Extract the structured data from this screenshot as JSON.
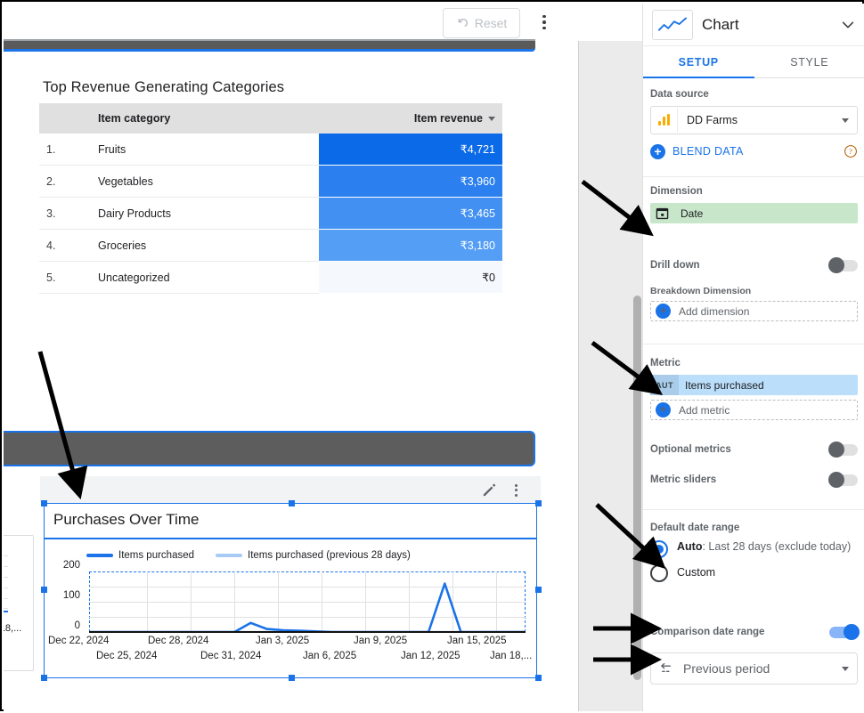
{
  "toolbar": {
    "reset_label": "Reset",
    "undo_icon": "undo-icon",
    "more_icon": "more-vertical-icon"
  },
  "report": {
    "table_widget": {
      "title": "Top Revenue Generating Categories",
      "columns": [
        "",
        "Item category",
        "Item revenue"
      ],
      "sort_column": "Item revenue",
      "rows": [
        {
          "rank": "1.",
          "category": "Fruits",
          "revenue": "₹4,721",
          "bar_color": "#0a6ae8",
          "bar_pct": 100
        },
        {
          "rank": "2.",
          "category": "Vegetables",
          "revenue": "₹3,960",
          "bar_color": "#2b7fef",
          "bar_pct": 84
        },
        {
          "rank": "3.",
          "category": "Dairy Products",
          "revenue": "₹3,465",
          "bar_color": "#4190f2",
          "bar_pct": 73
        },
        {
          "rank": "4.",
          "category": "Groceries",
          "revenue": "₹3,180",
          "bar_color": "#559ef6",
          "bar_pct": 67
        },
        {
          "rank": "5.",
          "category": "Uncategorized",
          "revenue": "₹0",
          "bar_color": "#f5f8fd",
          "bar_pct": 0
        }
      ]
    },
    "chart_widget": {
      "title": "Purchases Over Time",
      "edit_icon": "pencil-icon",
      "more_icon": "more-vertical-icon",
      "selected": true
    }
  },
  "chart_data": {
    "type": "line",
    "title": "Purchases Over Time",
    "xlabel": "",
    "ylabel": "",
    "ylim": [
      0,
      200
    ],
    "yticks": [
      0,
      100,
      200
    ],
    "grid": true,
    "legend_position": "top",
    "xtick_labels_row1": [
      "Dec 22, 2024",
      "Dec 28, 2024",
      "Jan 3, 2025",
      "Jan 9, 2025",
      "Jan 15, 2025"
    ],
    "xtick_labels_row2": [
      "Dec 25, 2024",
      "Dec 31, 2024",
      "Jan 6, 2025",
      "Jan 12, 2025",
      "Jan 18,..."
    ],
    "x": [
      "Dec 22, 2024",
      "Dec 23, 2024",
      "Dec 24, 2024",
      "Dec 25, 2024",
      "Dec 26, 2024",
      "Dec 27, 2024",
      "Dec 28, 2024",
      "Dec 29, 2024",
      "Dec 30, 2024",
      "Dec 31, 2024",
      "Jan 1, 2025",
      "Jan 2, 2025",
      "Jan 3, 2025",
      "Jan 4, 2025",
      "Jan 5, 2025",
      "Jan 6, 2025",
      "Jan 7, 2025",
      "Jan 8, 2025",
      "Jan 9, 2025",
      "Jan 10, 2025",
      "Jan 11, 2025",
      "Jan 12, 2025",
      "Jan 13, 2025",
      "Jan 14, 2025",
      "Jan 15, 2025",
      "Jan 16, 2025",
      "Jan 17, 2025",
      "Jan 18, 2025"
    ],
    "series": [
      {
        "name": "Items purchased",
        "color": "#1a73e8",
        "values": [
          0,
          0,
          0,
          0,
          0,
          0,
          0,
          0,
          0,
          0,
          30,
          10,
          6,
          4,
          2,
          0,
          0,
          0,
          0,
          0,
          0,
          0,
          160,
          0,
          0,
          0,
          0,
          0
        ]
      },
      {
        "name": "Items purchased (previous 28 days)",
        "color": "#a8cbf5",
        "values": [
          0,
          0,
          0,
          0,
          0,
          0,
          0,
          0,
          0,
          0,
          0,
          0,
          0,
          0,
          0,
          0,
          0,
          0,
          0,
          0,
          0,
          0,
          0,
          0,
          0,
          0,
          0,
          0
        ]
      }
    ]
  },
  "panel": {
    "header": {
      "chart_type_icon": "line-chart-icon",
      "title": "Chart",
      "collapse_icon": "chevron-down-icon"
    },
    "tabs": [
      {
        "label": "SETUP",
        "active": true
      },
      {
        "label": "STYLE",
        "active": false
      }
    ],
    "data_source": {
      "section_label": "Data source",
      "icon": "analytics-bars-icon",
      "name": "DD Farms",
      "dropdown_icon": "dropdown-caret-icon",
      "blend_label": "BLEND DATA",
      "blend_plus_icon": "plus-circle-icon",
      "help_icon": "help-circle-icon"
    },
    "dimension": {
      "section_label": "Dimension",
      "chip_icon": "calendar-icon",
      "chip_label": "Date",
      "chip_color": "#c8e6c9"
    },
    "drill_down": {
      "label": "Drill down",
      "state": "off"
    },
    "breakdown": {
      "section_label": "Breakdown Dimension",
      "add_label": "Add dimension",
      "add_icon": "plus-circle-icon"
    },
    "metric": {
      "section_label": "Metric",
      "badge": "AUT",
      "chip_label": "Items purchased",
      "chip_color": "#bbdefb",
      "add_label": "Add metric",
      "add_icon": "plus-circle-icon"
    },
    "optional_metrics": {
      "label": "Optional metrics",
      "state": "off"
    },
    "metric_sliders": {
      "label": "Metric sliders",
      "state": "off"
    },
    "default_date_range": {
      "section_label": "Default date range",
      "auto_strong": "Auto",
      "auto_rest": ": Last 28 days (exclude today)",
      "auto_selected": true,
      "custom_label": "Custom",
      "custom_selected": false
    },
    "comparison_date_range": {
      "label": "Comparison date range",
      "state": "on",
      "select_icon": "compare-arrows-icon",
      "select_value": "Previous period",
      "dropdown_icon": "dropdown-caret-icon"
    }
  },
  "annotations": {
    "arrow_count": 5,
    "arrow_color": "#000000",
    "targets": [
      "dimension-chip",
      "metric-chip",
      "default-date-range-auto",
      "comparison-date-range-toggle",
      "previous-period-select",
      "chart-widget"
    ]
  }
}
